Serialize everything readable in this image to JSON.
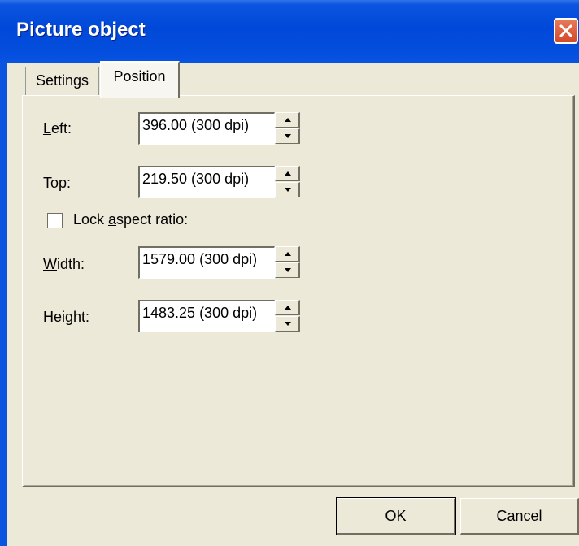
{
  "window": {
    "title": "Picture object"
  },
  "tabs": [
    {
      "label_prefix": "",
      "label_ul": "",
      "label": "Settings",
      "selected": false
    },
    {
      "label": "Position",
      "selected": true
    }
  ],
  "fields": {
    "left": {
      "label_ul": "L",
      "label_rest": "eft:",
      "value": "396.00 (300 dpi)"
    },
    "top": {
      "label_ul": "T",
      "label_rest": "op:",
      "value": "219.50 (300 dpi)"
    },
    "width": {
      "label_ul": "W",
      "label_rest": "idth:",
      "value": "1579.00 (300 dpi)"
    },
    "height": {
      "label_ul": "H",
      "label_rest": "eight:",
      "value": "1483.25 (300 dpi)"
    }
  },
  "lock_aspect": {
    "label_pre": "Lock ",
    "label_ul": "a",
    "label_post": "spect ratio:",
    "checked": false
  },
  "buttons": {
    "ok": "OK",
    "cancel": "Cancel"
  },
  "colors": {
    "titlebar": "#0a55e0",
    "dialog_bg": "#ece9d8",
    "close_button": "#d24a2a"
  },
  "icons": {
    "close": "close-icon",
    "spin_up": "arrow-up-icon",
    "spin_down": "arrow-down-icon"
  }
}
